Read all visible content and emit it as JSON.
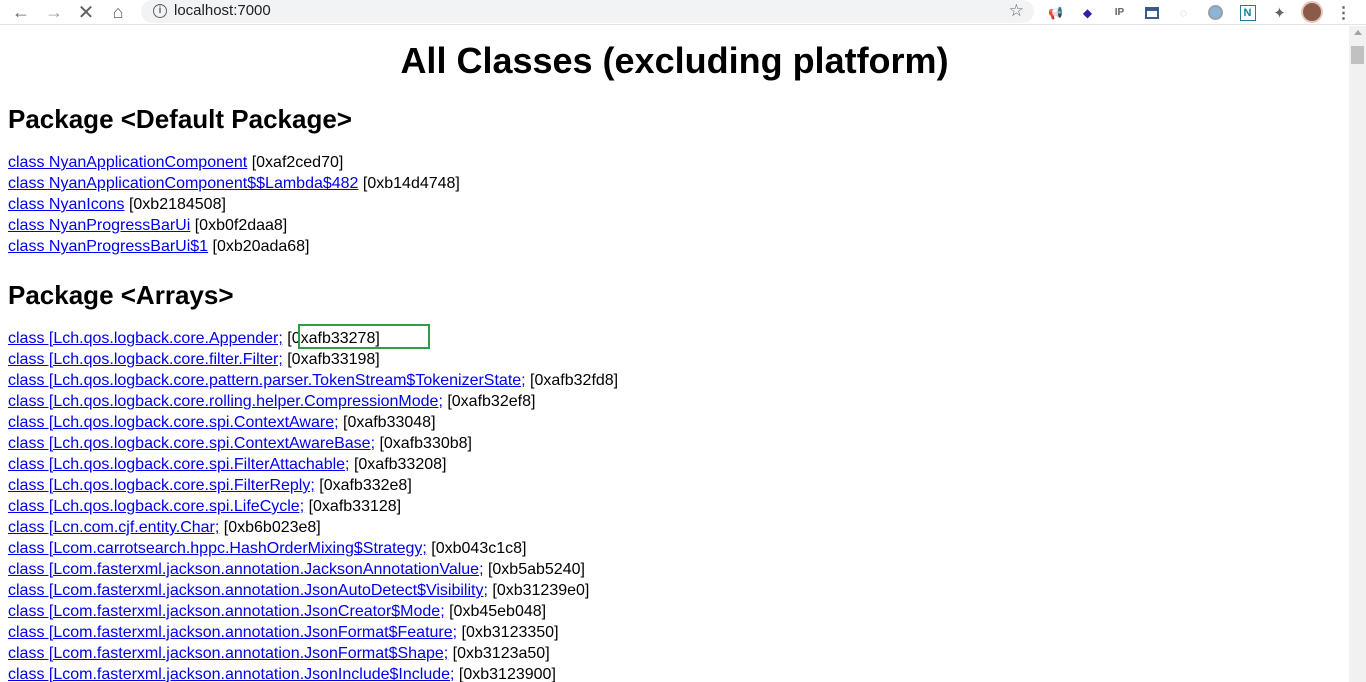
{
  "browser": {
    "url": "localhost:7000",
    "info_icon": "info-icon",
    "back_icon": "back-arrow-icon",
    "forward_icon": "forward-arrow-icon",
    "stop_icon": "stop-loading-icon",
    "home_icon": "home-icon",
    "bookmark_icon": "star-icon",
    "extensions": [
      "megaphone-icon",
      "diamond-icon",
      "ip-icon",
      "window-icon",
      "circle-loading-icon",
      "circle-grey-icon",
      "notion-n-icon",
      "puzzle-icon",
      "avatar",
      "menu-dots-icon"
    ]
  },
  "page": {
    "title": "All Classes (excluding platform)",
    "packages": [
      {
        "heading": "Package <Default Package>",
        "classes": [
          {
            "link": "class NyanApplicationComponent",
            "addr": " [0xaf2ced70]"
          },
          {
            "link": "class NyanApplicationComponent$$Lambda$482",
            "addr": " [0xb14d4748]"
          },
          {
            "link": "class NyanIcons",
            "addr": " [0xb2184508]"
          },
          {
            "link": "class NyanProgressBarUi",
            "addr": " [0xb0f2daa8]"
          },
          {
            "link": "class NyanProgressBarUi$1",
            "addr": " [0xb20ada68]"
          }
        ]
      },
      {
        "heading": "Package <Arrays>",
        "classes": [
          {
            "link": "class [Lch.qos.logback.core.Appender;",
            "addr": " [0xafb33278]"
          },
          {
            "link": "class [Lch.qos.logback.core.filter.Filter;",
            "addr": " [0xafb33198]"
          },
          {
            "link": "class [Lch.qos.logback.core.pattern.parser.TokenStream$TokenizerState;",
            "addr": " [0xafb32fd8]"
          },
          {
            "link": "class [Lch.qos.logback.core.rolling.helper.CompressionMode;",
            "addr": " [0xafb32ef8]"
          },
          {
            "link": "class [Lch.qos.logback.core.spi.ContextAware;",
            "addr": " [0xafb33048]"
          },
          {
            "link": "class [Lch.qos.logback.core.spi.ContextAwareBase;",
            "addr": " [0xafb330b8]"
          },
          {
            "link": "class [Lch.qos.logback.core.spi.FilterAttachable;",
            "addr": " [0xafb33208]"
          },
          {
            "link": "class [Lch.qos.logback.core.spi.FilterReply;",
            "addr": " [0xafb332e8]"
          },
          {
            "link": "class [Lch.qos.logback.core.spi.LifeCycle;",
            "addr": " [0xafb33128]"
          },
          {
            "link": "class [Lcn.com.cjf.entity.Char;",
            "addr": " [0xb6b023e8]"
          },
          {
            "link": "class [Lcom.carrotsearch.hppc.HashOrderMixing$Strategy;",
            "addr": " [0xb043c1c8]"
          },
          {
            "link": "class [Lcom.fasterxml.jackson.annotation.JacksonAnnotationValue;",
            "addr": " [0xb5ab5240]"
          },
          {
            "link": "class [Lcom.fasterxml.jackson.annotation.JsonAutoDetect$Visibility;",
            "addr": " [0xb31239e0]"
          },
          {
            "link": "class [Lcom.fasterxml.jackson.annotation.JsonCreator$Mode;",
            "addr": " [0xb45eb048]"
          },
          {
            "link": "class [Lcom.fasterxml.jackson.annotation.JsonFormat$Feature;",
            "addr": " [0xb3123350]"
          },
          {
            "link": "class [Lcom.fasterxml.jackson.annotation.JsonFormat$Shape;",
            "addr": " [0xb3123a50]"
          },
          {
            "link": "class [Lcom.fasterxml.jackson.annotation.JsonInclude$Include;",
            "addr": " [0xb3123900]"
          }
        ]
      }
    ]
  },
  "colors": {
    "link": "#0000ee",
    "highlight": "#2e9e4a"
  }
}
